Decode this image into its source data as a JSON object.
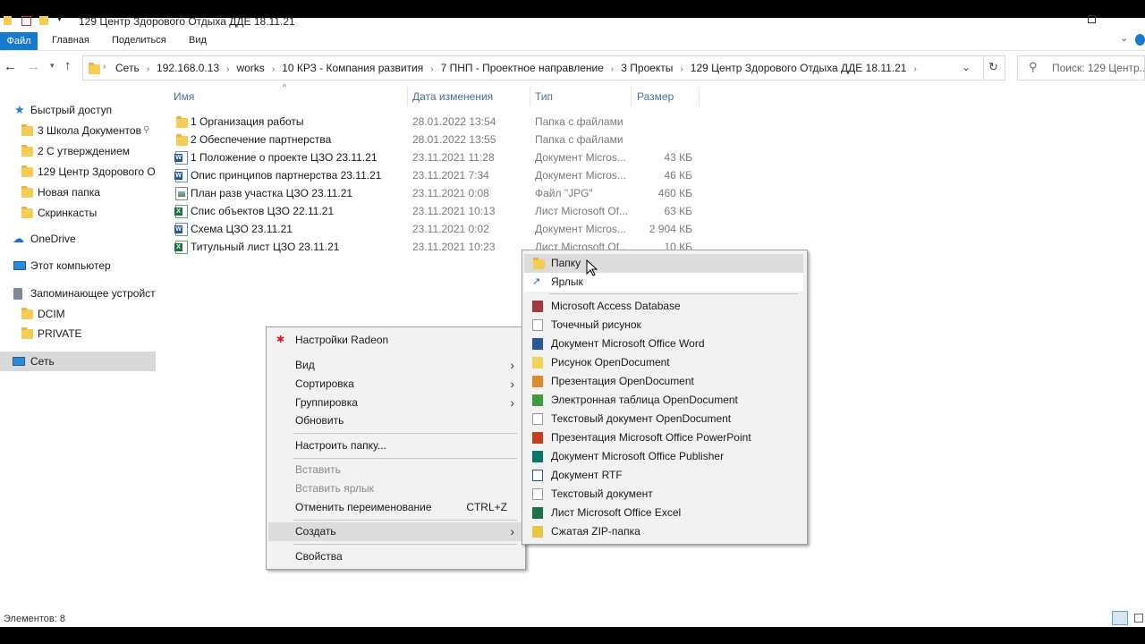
{
  "window": {
    "title": "129 Центр Здорового Отдыха ДДЕ 18.11.21"
  },
  "ribbon": {
    "tabs": [
      "Файл",
      "Главная",
      "Поделиться",
      "Вид"
    ]
  },
  "address": {
    "crumbs": [
      "Сеть",
      "192.168.0.13",
      "works",
      "10 КРЗ - Компания развития",
      "7 ПНП - Проектное направление",
      "3 Проекты",
      "129 Центр Здорового Отдыха ДДЕ 18.11.21"
    ],
    "search_placeholder": "Поиск: 129 Центр..."
  },
  "sidebar": {
    "quick_access": "Быстрый доступ",
    "pinned": [
      "3 Школа Документов",
      "2 С утверждением",
      "129 Центр Здорового Отд",
      "Новая папка",
      "Скринкасты"
    ],
    "onedrive": "OneDrive",
    "this_pc": "Этот компьютер",
    "storage": "Запоминающее устройств",
    "storage_items": [
      "DCIM",
      "PRIVATE"
    ],
    "network": "Сеть"
  },
  "columns": {
    "name": "Имя",
    "date": "Дата изменения",
    "type": "Тип",
    "size": "Размер"
  },
  "files": [
    {
      "name": "1 Организация работы",
      "date": "28.01.2022 13:54",
      "type": "Папка с файлами",
      "size": "",
      "icon": "folder-icon"
    },
    {
      "name": "2 Обеспечение партнерства",
      "date": "28.01.2022 13:55",
      "type": "Папка с файлами",
      "size": "",
      "icon": "folder-icon"
    },
    {
      "name": "1 Положение о проекте ЦЗО 23.11.21",
      "date": "23.11.2021 11:28",
      "type": "Документ Micros...",
      "size": "43 КБ",
      "icon": "word-doc-icon"
    },
    {
      "name": "Опис принципов партнерства 23.11.21",
      "date": "23.11.2021 7:34",
      "type": "Документ Micros...",
      "size": "46 КБ",
      "icon": "word-doc-icon"
    },
    {
      "name": "План разв участка ЦЗО 23.11.21",
      "date": "23.11.2021 0:08",
      "type": "Файл \"JPG\"",
      "size": "460 КБ",
      "icon": "image-icon"
    },
    {
      "name": "Спис объектов ЦЗО 22.11.21",
      "date": "23.11.2021 10:13",
      "type": "Лист Microsoft Of...",
      "size": "63 КБ",
      "icon": "excel-icon"
    },
    {
      "name": "Схема ЦЗО 23.11.21",
      "date": "23.11.2021 0:02",
      "type": "Документ Micros...",
      "size": "2 904 КБ",
      "icon": "word-doc-icon"
    },
    {
      "name": "Титульный лист ЦЗО 23.11.21",
      "date": "23.11.2021 10:23",
      "type": "Лист Microsoft Of...",
      "size": "10 КБ",
      "icon": "excel-icon"
    }
  ],
  "context_menu": {
    "radeon": "Настройки Radeon",
    "view": "Вид",
    "sort": "Сортировка",
    "group": "Группировка",
    "refresh": "Обновить",
    "customize": "Настроить папку...",
    "paste": "Вставить",
    "paste_shortcut": "Вставить ярлык",
    "undo_rename": "Отменить переименование",
    "undo_shortcut": "CTRL+Z",
    "create": "Создать",
    "properties": "Свойства"
  },
  "submenu": {
    "folder": "Папку",
    "shortcut": "Ярлык",
    "items": [
      "Microsoft Access Database",
      "Точечный рисунок",
      "Документ Microsoft Office Word",
      "Рисунок OpenDocument",
      "Презентация OpenDocument",
      "Электронная таблица OpenDocument",
      "Текстовый документ OpenDocument",
      "Презентация Microsoft Office PowerPoint",
      "Документ Microsoft Office Publisher",
      "Документ RTF",
      "Текстовый документ",
      "Лист Microsoft Office Excel",
      "Сжатая ZIP-папка"
    ]
  },
  "status": {
    "items_count": "Элементов: 8"
  }
}
